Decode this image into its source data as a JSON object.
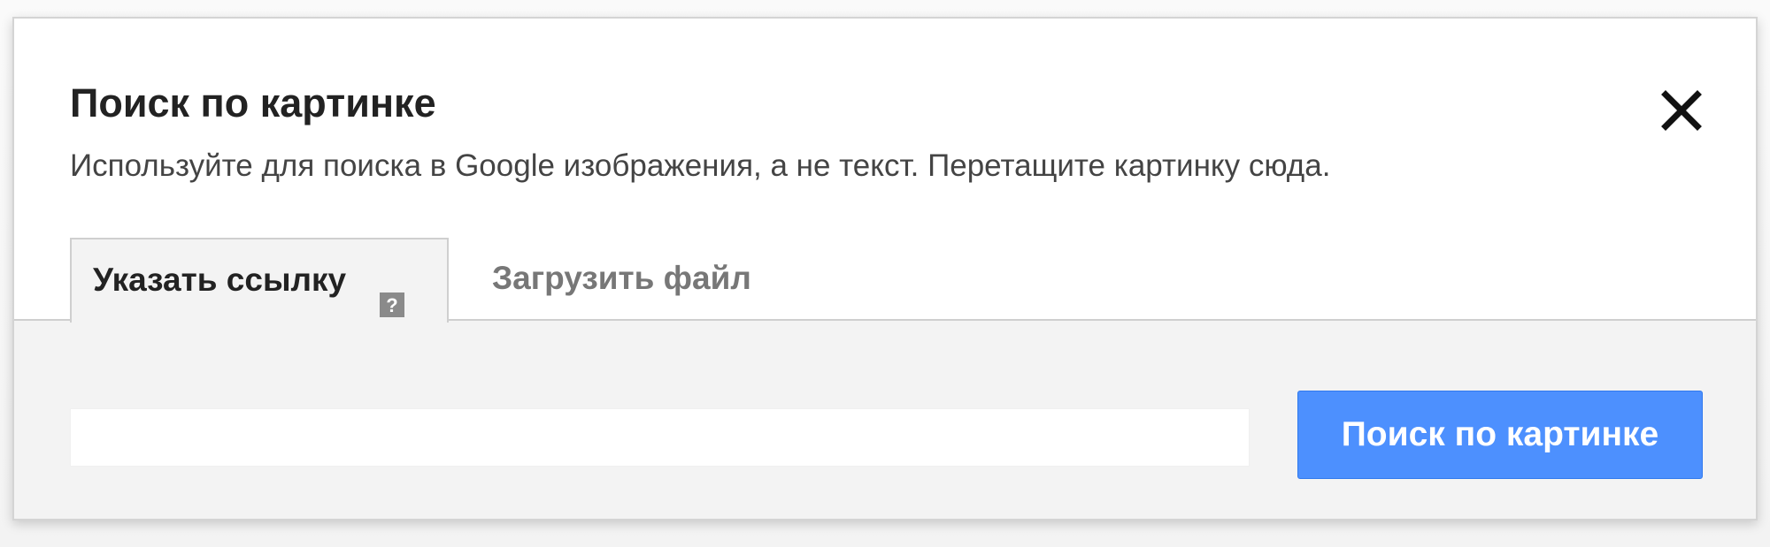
{
  "dialog": {
    "title": "Поиск по картинке",
    "description": "Используйте для поиска в Google изображения, а не текст. Перетащите картинку сюда.",
    "close_icon": "close-icon"
  },
  "tabs": [
    {
      "label": "Указать ссылку",
      "active": true,
      "icon": "help-icon"
    },
    {
      "label": "Загрузить файл",
      "active": false
    }
  ],
  "url_panel": {
    "input_value": "",
    "input_placeholder": "",
    "search_button_label": "Поиск по картинке"
  },
  "colors": {
    "button_bg": "#4d90fe",
    "panel_bg": "#f3f3f3",
    "title_text": "#222222",
    "inactive_tab_text": "#777777"
  }
}
